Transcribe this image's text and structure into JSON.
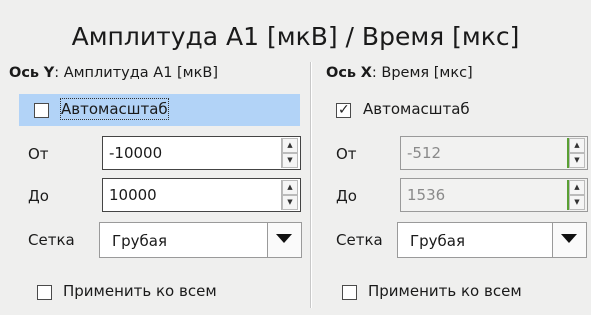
{
  "title": "Амплитуда А1 [мкВ] / Время [мкс]",
  "y_axis": {
    "head_prefix": "Ось",
    "head_axis": "Y",
    "head_desc": ": Амплитуда А1 [мкВ]",
    "autoscale_label": "Автомасштаб",
    "autoscale_checked": false,
    "from_label": "От",
    "from_value": "-10000",
    "to_label": "До",
    "to_value": "10000",
    "grid_label": "Сетка",
    "grid_value": "Грубая",
    "apply_all_label": "Применить ко всем"
  },
  "x_axis": {
    "head_prefix": "Ось",
    "head_axis": "X",
    "head_desc": ": Время [мкс]",
    "autoscale_label": "Автомасштаб",
    "autoscale_checked": true,
    "from_label": "От",
    "from_value": "-512",
    "to_label": "До",
    "to_value": "1536",
    "grid_label": "Сетка",
    "grid_value": "Грубая",
    "apply_all_label": "Применить ко всем"
  },
  "icons": {
    "spin_up": "arrow-up-icon",
    "spin_down": "arrow-down-icon",
    "dropdown": "triangle-down-icon",
    "check": "check-mark-icon"
  },
  "colors": {
    "background": "#efefee",
    "selection": "#b2d3f7",
    "disabled_spin_accent": "#5aa033"
  }
}
